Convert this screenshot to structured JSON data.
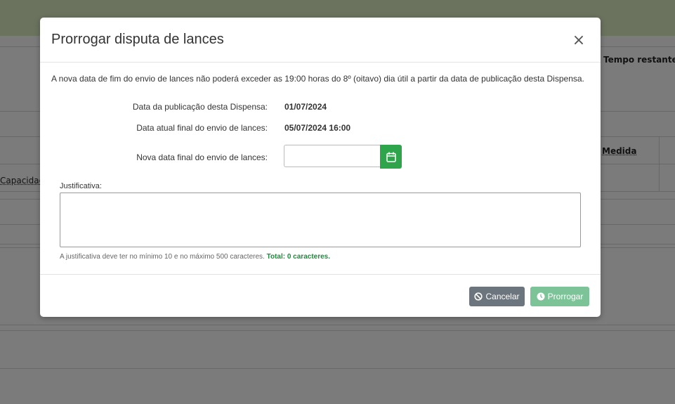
{
  "background": {
    "remaining_time_label": "Tempo restante pa",
    "measure_label": "Medida",
    "capacity_label": "Capacidade"
  },
  "modal": {
    "title": "Prorrogar disputa de lances",
    "close_glyph": "×",
    "notice": "A nova data de fim do envio de lances não poderá exceder as 19:00 horas do 8º (oitavo) dia útil a partir da data de publicação desta Dispensa.",
    "publication_label": "Data da publicação desta Dispensa:",
    "publication_value": "01/07/2024",
    "current_end_label": "Data atual final do envio de lances:",
    "current_end_value": "05/07/2024 16:00",
    "new_end_label": "Nova data final do envio de lances:",
    "new_end_value": "",
    "justification_label": "Justificativa:",
    "justification_value": "",
    "help_text": "A justificativa deve ter no mínimo 10 e no máximo 500 caracteres.",
    "char_count": "Total: 0 caracteres.",
    "cancel_label": "Cancelar",
    "extend_label": "Prorrogar"
  }
}
